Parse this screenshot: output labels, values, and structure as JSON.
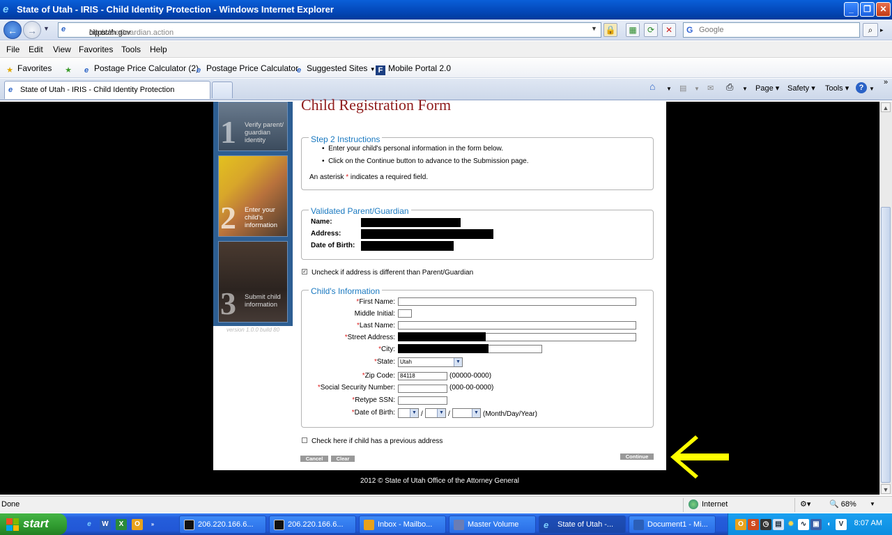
{
  "window": {
    "title": "State of Utah - IRIS - Child Identity Protection - Windows Internet Explorer"
  },
  "address": {
    "prefix": "https://",
    "host": "cip.utah.gov",
    "path": "/cip/saveGuardian.action",
    "search_placeholder": "Google"
  },
  "menu": [
    "File",
    "Edit",
    "View",
    "Favorites",
    "Tools",
    "Help"
  ],
  "favorites": {
    "label": "Favorites",
    "items": [
      "Postage Price Calculator (2)",
      "Postage Price Calculator",
      "Suggested Sites",
      "Mobile Portal 2.0"
    ]
  },
  "tab": {
    "title": "State of Utah - IRIS - Child Identity Protection"
  },
  "commandbar": {
    "page": "Page",
    "safety": "Safety",
    "tools": "Tools"
  },
  "sidebar": {
    "steps": [
      {
        "num": "1",
        "label": "Verify parent/ guardian identity"
      },
      {
        "num": "2",
        "label": "Enter your child's information"
      },
      {
        "num": "3",
        "label": "Submit child information"
      }
    ],
    "version": "version 1.0.0 build 80"
  },
  "form": {
    "title": "Child Registration Form",
    "instructions": {
      "legend": "Step 2 Instructions",
      "bullets": [
        "Enter your child's personal information in the form below.",
        "Click on the Continue button to advance to the Submission page."
      ],
      "required_pre": "An asterisk ",
      "required_star": "*",
      "required_post": " indicates a required field."
    },
    "guardian": {
      "legend": "Validated Parent/Guardian",
      "name_label": "Name:",
      "address_label": "Address:",
      "dob_label": "Date of Birth:"
    },
    "uncheck_label": "Uncheck if address is different than Parent/Guardian",
    "child": {
      "legend": "Child's Information",
      "first_name": "First Name:",
      "middle_initial": "Middle Initial:",
      "last_name": "Last Name:",
      "street": "Street Address:",
      "city": "City:",
      "state": "State:",
      "state_value": "Utah",
      "zip": "Zip Code:",
      "zip_value": "84118",
      "zip_hint": "(00000-0000)",
      "ssn": "Social Security Number:",
      "ssn_hint": "(000-00-0000)",
      "retype_ssn": "Retype SSN:",
      "dob": "Date of Birth:",
      "dob_sep": "/",
      "dob_hint": "(Month/Day/Year)"
    },
    "prev_address_label": "Check here if child has a previous address",
    "buttons": {
      "cancel": "Cancel",
      "clear": "Clear",
      "continue": "Continue"
    }
  },
  "footer": "2012 © State of Utah Office of the Attorney General",
  "status": {
    "text": "Done",
    "zone": "Internet",
    "zoom": "68%"
  },
  "taskbar": {
    "start": "start",
    "tasks": [
      "206.220.166.6...",
      "206.220.166.6...",
      "Inbox - Mailbo...",
      "Master Volume",
      "State of Utah -...",
      "Document1 - Mi..."
    ],
    "clock": "8:07 AM"
  },
  "colors": {
    "title_red": "#8f1b1b",
    "legend_blue": "#1a79c0",
    "sidebar_blue": "#2d5e92",
    "arrow_yellow": "#ffff00"
  }
}
